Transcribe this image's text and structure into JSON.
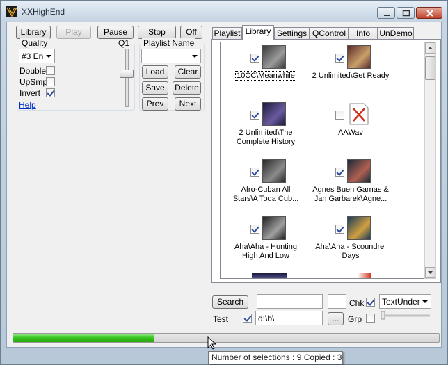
{
  "window": {
    "title": "XXHighEnd"
  },
  "toolbar": {
    "library": "Library",
    "play": "Play",
    "pause": "Pause",
    "stop": "Stop",
    "off": "Off"
  },
  "quality": {
    "label": "Quality",
    "q_label": "Q1",
    "selected": "#3 En",
    "double_label": "Double",
    "double_checked": false,
    "upsmp_label": "UpSmp",
    "upsmp_checked": false,
    "invert_label": "Invert",
    "invert_checked": true,
    "help_label": "Help"
  },
  "playlist": {
    "label": "Playlist Name",
    "selected": "",
    "load": "Load",
    "clear": "Clear",
    "save": "Save",
    "delete": "Delete",
    "prev": "Prev",
    "next": "Next"
  },
  "tabs": [
    {
      "label": "Playlist",
      "active": false
    },
    {
      "label": "Library",
      "active": true
    },
    {
      "label": "Settings",
      "active": false
    },
    {
      "label": "QControl",
      "active": false
    },
    {
      "label": "Info",
      "active": false
    },
    {
      "label": "UnDemo",
      "active": false
    }
  ],
  "library_items": [
    {
      "caption_lines": [
        "10CC\\Meanwhile"
      ],
      "checked": true,
      "thumb": "album-cover",
      "focused": true
    },
    {
      "caption_lines": [
        "2 Unlimited\\Get Ready"
      ],
      "checked": true,
      "thumb": "album-cover",
      "focused": false
    },
    {
      "caption_lines": [
        "2 Unlimited\\The",
        "Complete History"
      ],
      "checked": true,
      "thumb": "album-cover",
      "focused": false
    },
    {
      "caption_lines": [
        "AAWav"
      ],
      "checked": false,
      "thumb": "missing-image-icon",
      "focused": false
    },
    {
      "caption_lines": [
        "Afro-Cuban All",
        "Stars\\A Toda Cub..."
      ],
      "checked": true,
      "thumb": "album-cover",
      "focused": false
    },
    {
      "caption_lines": [
        "Agnes Buen Garnas &",
        "Jan Garbarek\\Agne..."
      ],
      "checked": true,
      "thumb": "album-cover",
      "focused": false
    },
    {
      "caption_lines": [
        "Aha\\Aha - Hunting",
        "High And Low"
      ],
      "checked": true,
      "thumb": "album-cover",
      "focused": false
    },
    {
      "caption_lines": [
        "Aha\\Aha - Scoundrel",
        "Days"
      ],
      "checked": true,
      "thumb": "album-cover",
      "focused": false
    }
  ],
  "bottom": {
    "search_label": "Search",
    "search_value": "",
    "chk_label": "Chk",
    "chk_checked": true,
    "view_mode": "TextUnder",
    "test_label": "Test",
    "test_checked": true,
    "path_value": "d:\\b\\",
    "browse_label": "...",
    "grp_label": "Grp",
    "grp_checked": false
  },
  "progress": {
    "fraction": 0.33
  },
  "tooltip": {
    "text": "Number of selections : 9 Copied : 3"
  },
  "colors": {
    "progress_green": "#37c21e",
    "link_blue": "#0033cc",
    "missing_x_red": "#d0301a"
  }
}
